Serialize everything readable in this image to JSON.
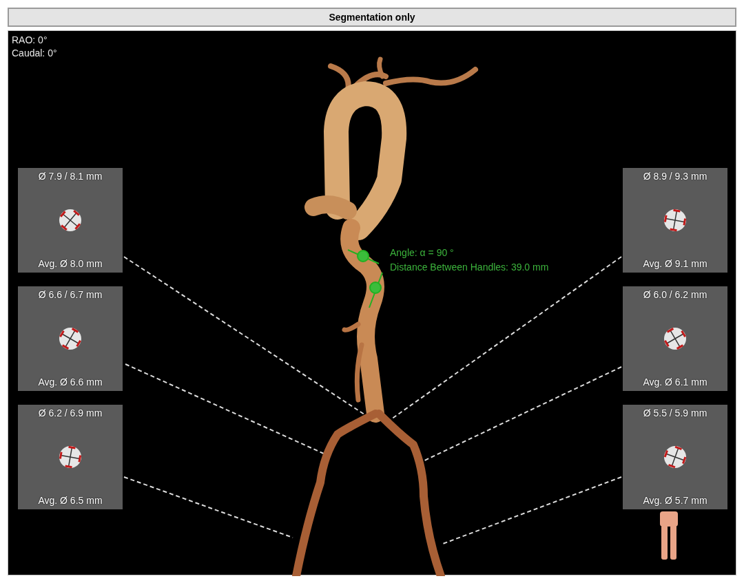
{
  "window": {
    "title": "Segmentation only"
  },
  "view_angles": [
    "RAO: 0°",
    "Caudal: 0°"
  ],
  "measurement": {
    "angle": "Angle: α = 90 °",
    "distance": "Distance Between Handles: 39.0 mm"
  },
  "left_sections": [
    {
      "diameters": "Ø 7.9 / 8.1 mm",
      "average": "Avg. Ø 8.0 mm"
    },
    {
      "diameters": "Ø 6.6 / 6.7 mm",
      "average": "Avg. Ø 6.6 mm"
    },
    {
      "diameters": "Ø 6.2 / 6.9 mm",
      "average": "Avg. Ø 6.5 mm"
    }
  ],
  "right_sections": [
    {
      "diameters": "Ø 8.9 / 9.3 mm",
      "average": "Avg. Ø 9.1 mm"
    },
    {
      "diameters": "Ø 6.0 / 6.2 mm",
      "average": "Avg. Ø 6.1 mm"
    },
    {
      "diameters": "Ø 5.5 / 5.9 mm",
      "average": "Avg. Ø 5.7 mm"
    }
  ]
}
